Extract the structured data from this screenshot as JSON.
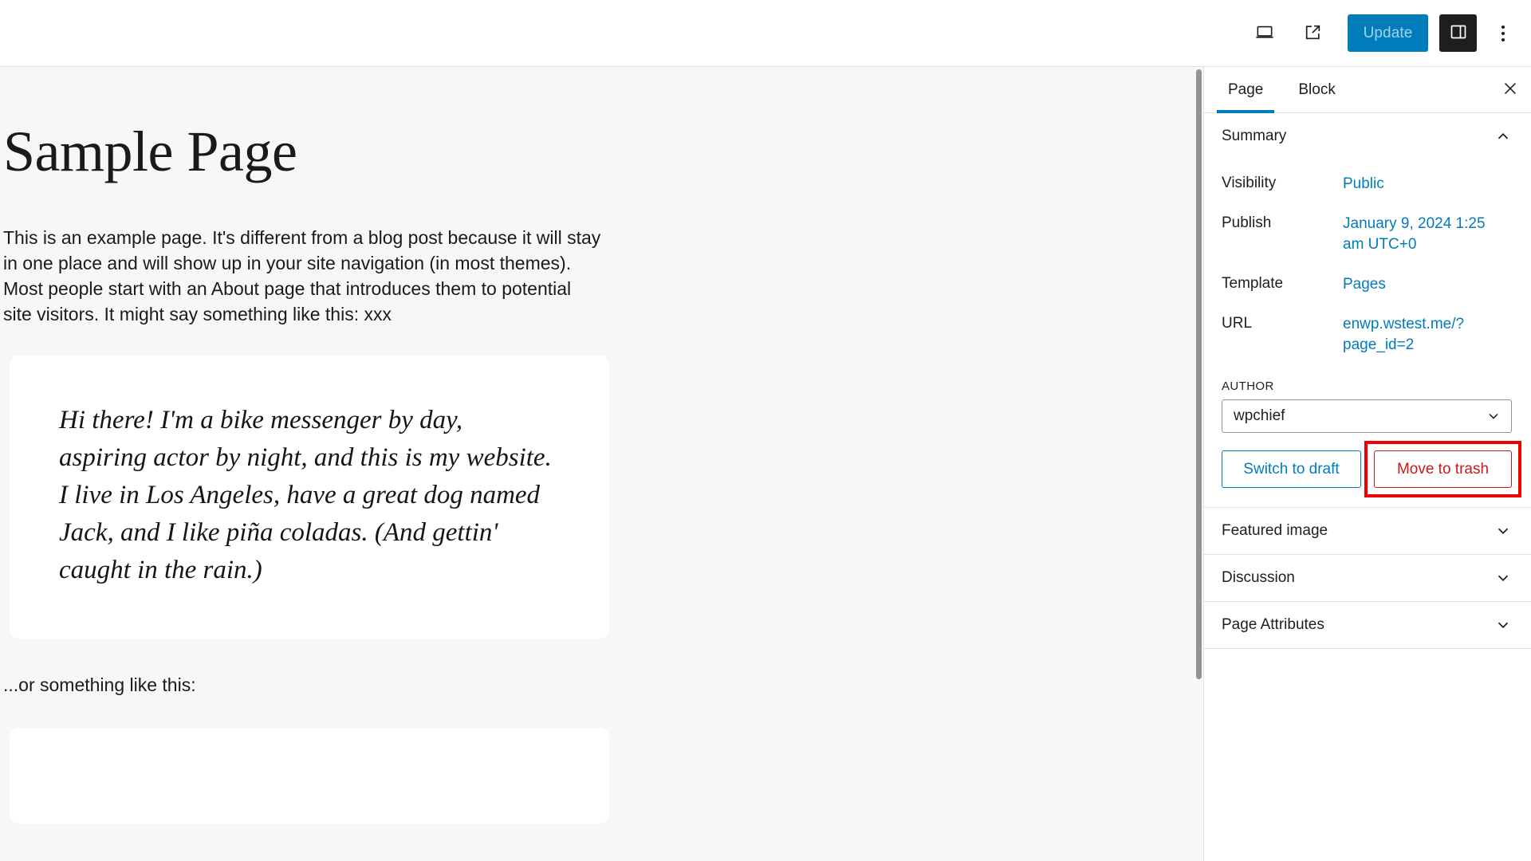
{
  "toolbar": {
    "view_icon": "laptop-icon",
    "preview_icon": "external-link-icon",
    "update_label": "Update",
    "settings_icon": "sidebar-panel-icon",
    "options_icon": "kebab-menu-icon"
  },
  "editor": {
    "title": "Sample Page",
    "paragraph": "This is an example page. It's different from a blog post because it will stay in one place and will show up in your site navigation (in most themes). Most people start with an About page that introduces them to potential site visitors. It might say something like this: xxx",
    "quote": "Hi there! I'm a bike messenger by day, aspiring actor by night, and this is my website. I live in Los Angeles, have a great dog named Jack, and I like piña coladas. (And gettin' caught in the rain.)",
    "tail_paragraph": "...or something like this:"
  },
  "sidebar": {
    "tabs": [
      {
        "label": "Page",
        "active": true
      },
      {
        "label": "Block",
        "active": false
      }
    ],
    "close_icon": "close-icon",
    "summary": {
      "title": "Summary",
      "chevron": "chevron-up-icon",
      "rows": [
        {
          "label": "Visibility",
          "value": "Public"
        },
        {
          "label": "Publish",
          "value": "January 9, 2024 1:25 am UTC+0"
        },
        {
          "label": "Template",
          "value": "Pages"
        },
        {
          "label": "URL",
          "value": "enwp.wstest.me/?page_id=2"
        }
      ],
      "author_label": "AUTHOR",
      "author_value": "wpchief",
      "author_chevron": "chevron-down-icon",
      "switch_draft_label": "Switch to draft",
      "move_trash_label": "Move to trash"
    },
    "panels": [
      {
        "label": "Featured image",
        "chevron": "chevron-down-icon"
      },
      {
        "label": "Discussion",
        "chevron": "chevron-down-icon"
      },
      {
        "label": "Page Attributes",
        "chevron": "chevron-down-icon"
      }
    ]
  },
  "colors": {
    "accent": "#007cba",
    "danger": "#cc1818",
    "annotation": "#ee0000",
    "canvas_bg": "#f7f7f7"
  }
}
